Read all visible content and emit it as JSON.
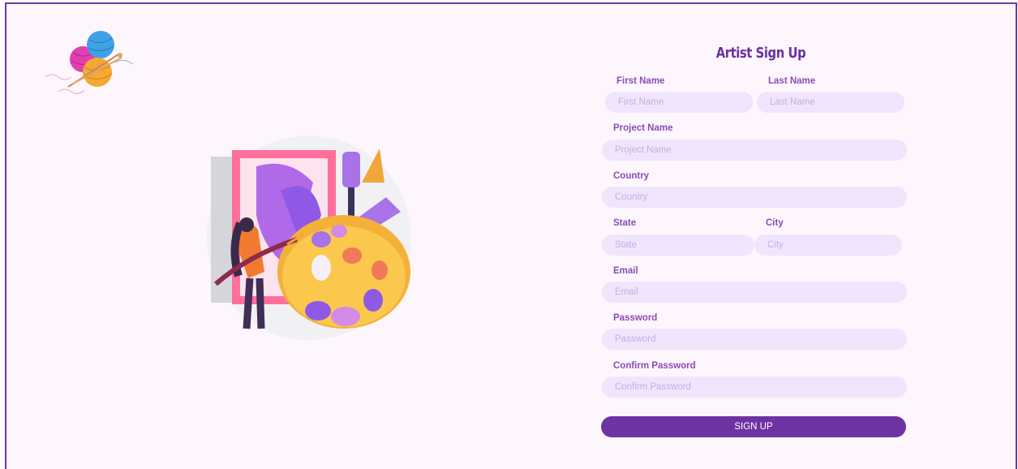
{
  "form": {
    "title": "Artist Sign Up",
    "first_name": {
      "label": "First Name",
      "placeholder": "First Name"
    },
    "last_name": {
      "label": "Last Name",
      "placeholder": "Last Name"
    },
    "project_name": {
      "label": "Project Name",
      "placeholder": "Project Name"
    },
    "country": {
      "label": "Country",
      "placeholder": "Country"
    },
    "state": {
      "label": "State",
      "placeholder": "State"
    },
    "city": {
      "label": "City",
      "placeholder": "City"
    },
    "email": {
      "label": "Email",
      "placeholder": "Email"
    },
    "password": {
      "label": "Password",
      "placeholder": "Password"
    },
    "confirm_password": {
      "label": "Confirm Password",
      "placeholder": "Confirm Password"
    },
    "submit_label": "SIGN UP"
  },
  "colors": {
    "page_background": "#fdf6fc",
    "border": "#6a3aa6",
    "title": "#6b2fa3",
    "label": "#8a4cb8",
    "input_background": "#efe5fd",
    "button": "#6e33a3"
  },
  "icons": {
    "logo": "yarn-balls-logo",
    "illustration": "artist-painting-illustration"
  }
}
